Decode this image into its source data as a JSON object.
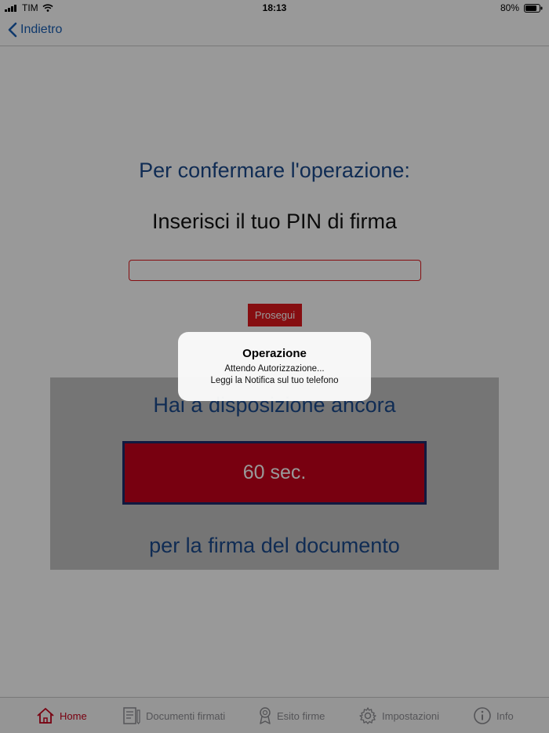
{
  "status_bar": {
    "carrier": "TIM",
    "time": "18:13",
    "battery": "80%"
  },
  "nav": {
    "back_label": "Indietro"
  },
  "main": {
    "heading": "Per confermare l'operazione:",
    "subheading": "Inserisci il tuo PIN di firma",
    "pin_value": "",
    "proceed_label": "Prosegui",
    "timer": {
      "top_text": "Hai a disposizione ancora",
      "value": "60 sec.",
      "bottom_text": "per la firma del documento"
    }
  },
  "alert": {
    "title": "Operazione",
    "line1": "Attendo Autorizzazione...",
    "line2": "Leggi la Notifica sul tuo telefono"
  },
  "tabs": [
    {
      "label": "Home",
      "icon": "home-icon",
      "active": true
    },
    {
      "label": "Documenti firmati",
      "icon": "document-icon",
      "active": false
    },
    {
      "label": "Esito firme",
      "icon": "award-icon",
      "active": false
    },
    {
      "label": "Impostazioni",
      "icon": "gear-icon",
      "active": false
    },
    {
      "label": "Info",
      "icon": "info-icon",
      "active": false
    }
  ],
  "colors": {
    "accent_red": "#e0181d",
    "timer_red": "#c9001b",
    "heading_blue": "#1b4a8c",
    "link_blue": "#1a5fb4"
  }
}
